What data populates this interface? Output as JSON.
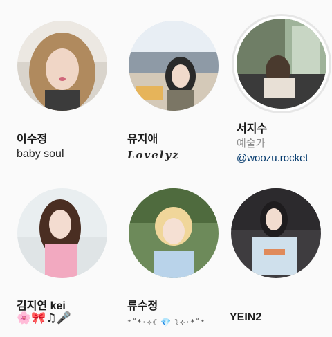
{
  "profiles": [
    {
      "name": "이수정",
      "subtitle": "baby soul",
      "avatar": "woman-wavy-hair-photo"
    },
    {
      "name": "유지애",
      "subtitle": "𝓛𝓸𝓿𝓮𝓵𝔂𝔃",
      "avatar": "woman-sitting-rooftop-photo"
    },
    {
      "name": "서지수",
      "category": "예술가",
      "subtitle": "@woozu.rocket",
      "avatar": "woman-reading-window-photo",
      "has_story_ring": true
    },
    {
      "name": "김지연 kei",
      "subtitle": "🌸🎀♫🎤",
      "avatar": "woman-pink-top-sofa-photo"
    },
    {
      "name": "류수정",
      "subtitle": "⁺˚*･༓☾💎☽༓･*˚⁺",
      "avatar": "woman-blonde-bangs-photo"
    },
    {
      "name": "YEIN2",
      "subtitle": "",
      "avatar": "woman-sweatshirt-photo"
    }
  ],
  "colors": {
    "link": "#00376b",
    "muted": "#8e8e8e",
    "ring": "#e6e6e6"
  }
}
